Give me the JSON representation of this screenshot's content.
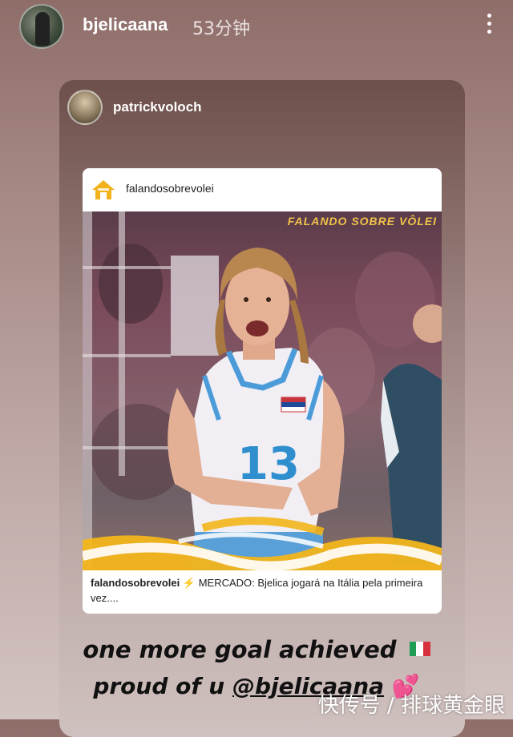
{
  "header": {
    "username": "bjelicaana",
    "timestamp": "53分钟",
    "more_icon": "more-vertical-icon"
  },
  "shared": {
    "sharer_username": "patrickvoloch"
  },
  "post": {
    "account": "falandosobrevolei",
    "account_icon": "house-icon",
    "banner_text": "FALANDO SOBRE VÔLEI",
    "jersey_number": "13",
    "caption_account": "falandosobrevolei",
    "caption_bolt": "⚡",
    "caption_text": "MERCADO: Bjelica jogará na Itália pela primeira vez...."
  },
  "note": {
    "line1": "one more goal achieved",
    "flag": "italy-flag",
    "line2_prefix": "proud of u ",
    "mention": "@bjelicaana",
    "hearts": "💕"
  },
  "watermark": "快传号 / 排球黄金眼",
  "colors": {
    "banner": "#f0c24a",
    "jersey_number": "#2f8fce",
    "bolt": "#f3b51b"
  }
}
